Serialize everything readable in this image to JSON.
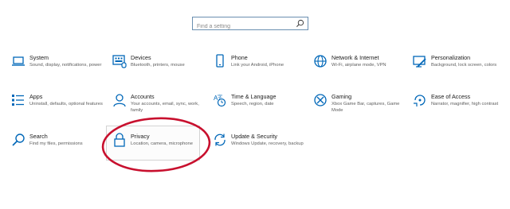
{
  "search": {
    "placeholder": "Find a setting"
  },
  "tiles": [
    {
      "title": "System",
      "desc": "Sound, display, notifications, power",
      "icon": "laptop-icon"
    },
    {
      "title": "Devices",
      "desc": "Bluetooth, printers, mouse",
      "icon": "keyboard-icon"
    },
    {
      "title": "Phone",
      "desc": "Link your Android, iPhone",
      "icon": "phone-icon"
    },
    {
      "title": "Network & Internet",
      "desc": "Wi-Fi, airplane mode, VPN",
      "icon": "globe-icon"
    },
    {
      "title": "Personalization",
      "desc": "Background, lock screen, colors",
      "icon": "paint-icon"
    },
    {
      "title": "Apps",
      "desc": "Uninstall, defaults, optional features",
      "icon": "apps-list-icon"
    },
    {
      "title": "Accounts",
      "desc": "Your accounts, email, sync, work, family",
      "icon": "person-icon"
    },
    {
      "title": "Time & Language",
      "desc": "Speech, region, date",
      "icon": "time-language-icon"
    },
    {
      "title": "Gaming",
      "desc": "Xbox Game Bar, captures, Game Mode",
      "icon": "xbox-icon"
    },
    {
      "title": "Ease of Access",
      "desc": "Narrator, magnifier, high contrast",
      "icon": "ease-of-access-icon"
    },
    {
      "title": "Search",
      "desc": "Find my files, permissions",
      "icon": "search-icon"
    },
    {
      "title": "Privacy",
      "desc": "Location, camera, microphone",
      "icon": "lock-icon"
    },
    {
      "title": "Update & Security",
      "desc": "Windows Update, recovery, backup",
      "icon": "sync-icon"
    }
  ],
  "colors": {
    "accent": "#0067b8",
    "annotation": "#c8102e"
  }
}
